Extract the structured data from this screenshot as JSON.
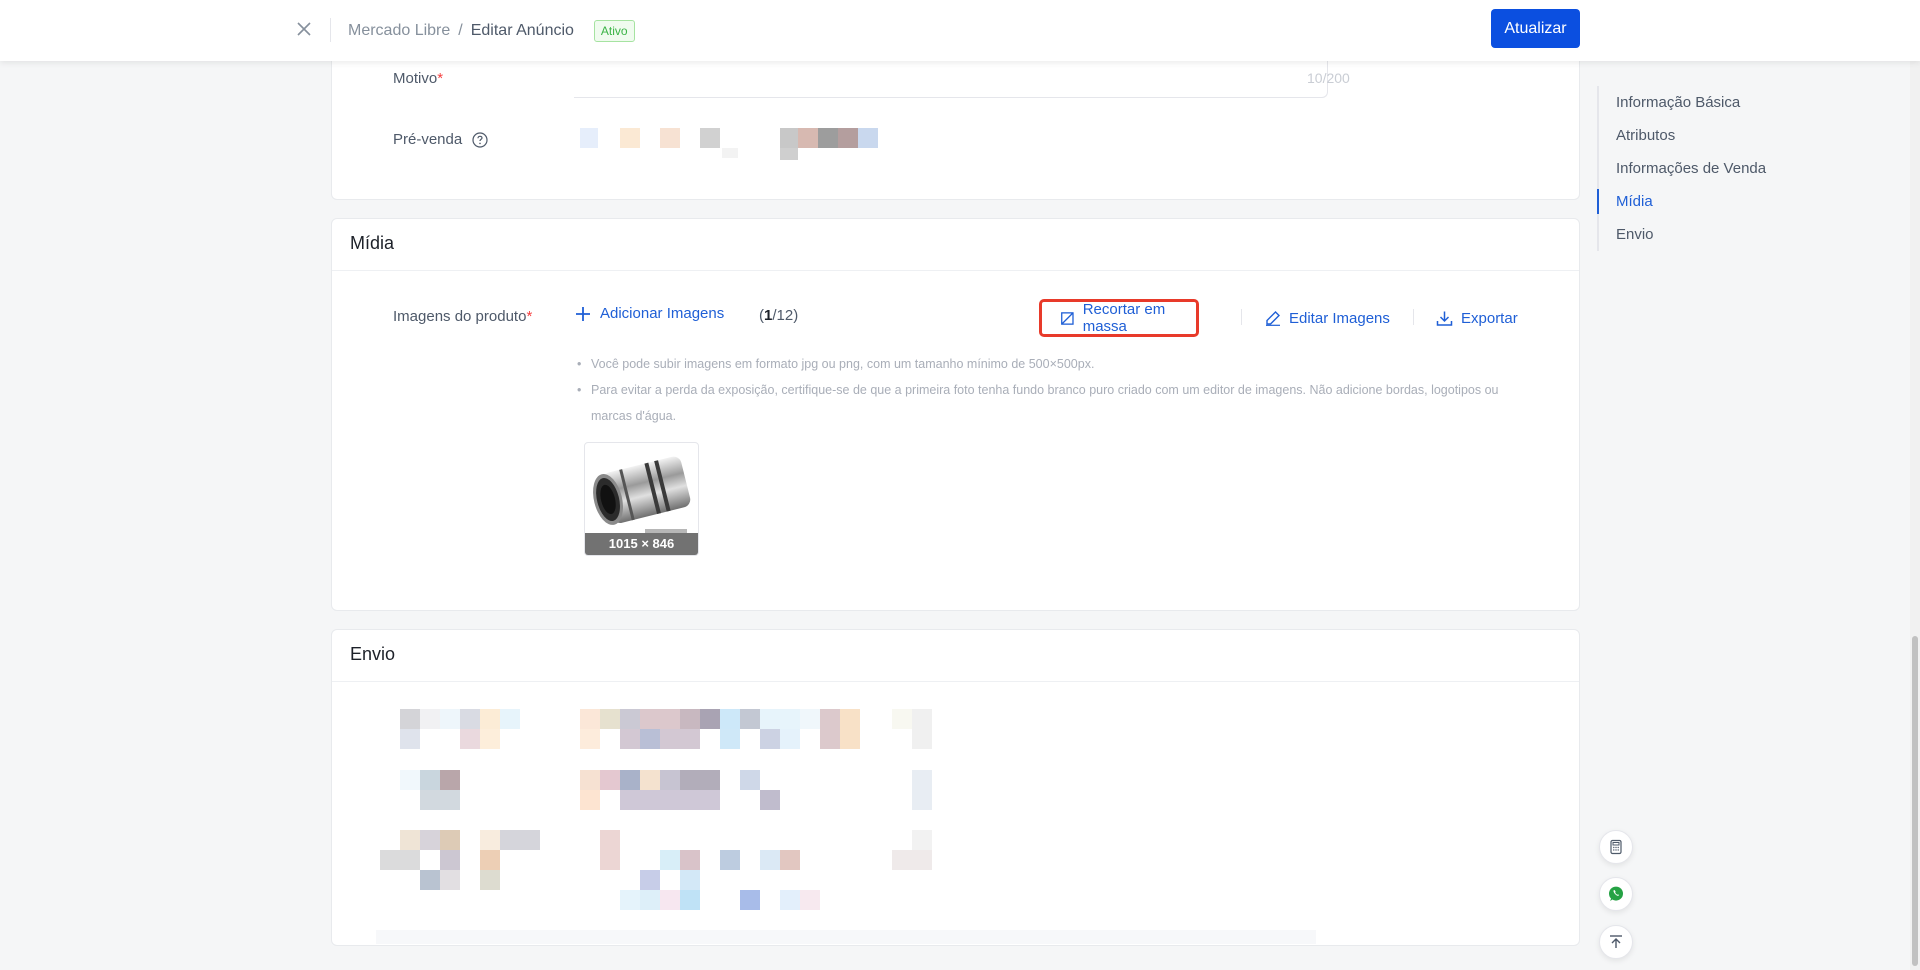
{
  "header": {
    "breadcrumb_parent": "Mercado Libre",
    "breadcrumb_separator": "/",
    "breadcrumb_current": "Editar Anúncio",
    "status_badge": "Ativo",
    "update_button": "Atualizar"
  },
  "basic": {
    "motivo_label": "Motivo",
    "required_mark": "*",
    "counter": "10/200",
    "presale_label": "Pré-venda"
  },
  "media": {
    "title": "Mídia",
    "images_label": "Imagens do produto",
    "add_images": "Adicionar Imagens",
    "count_open": "(",
    "count_current": "1",
    "count_total": "/12)",
    "crop_bulk": "Recortar em massa",
    "edit_images": "Editar Imagens",
    "export": "Exportar",
    "tips": [
      "Você pode subir imagens em formato jpg ou png, com um tamanho mínimo de 500×500px.",
      "Para evitar a perda da exposição, certifique-se de que a primeira foto tenha fundo branco puro criado com um editor de imagens. Não adicione bordas, logotipos ou marcas d'água."
    ],
    "thumbnail_caption": "1015 × 846"
  },
  "shipping": {
    "title": "Envio"
  },
  "sidenav": {
    "items": [
      {
        "label": "Informação Básica",
        "active": false
      },
      {
        "label": "Atributos",
        "active": false
      },
      {
        "label": "Informações de Venda",
        "active": false
      },
      {
        "label": "Mídia",
        "active": true
      },
      {
        "label": "Envio",
        "active": false
      }
    ]
  },
  "colors": {
    "primary": "#0b4fe0",
    "link": "#1f5fd6",
    "highlight_border": "#e83a2a",
    "active_green": "#3bb346",
    "required_red": "#f53f3f"
  },
  "icons": [
    "close-icon",
    "help-circle-icon",
    "plus-icon",
    "crop-icon",
    "edit-pen-icon",
    "download-icon",
    "calculator-icon",
    "whatsapp-icon",
    "back-to-top-icon"
  ]
}
